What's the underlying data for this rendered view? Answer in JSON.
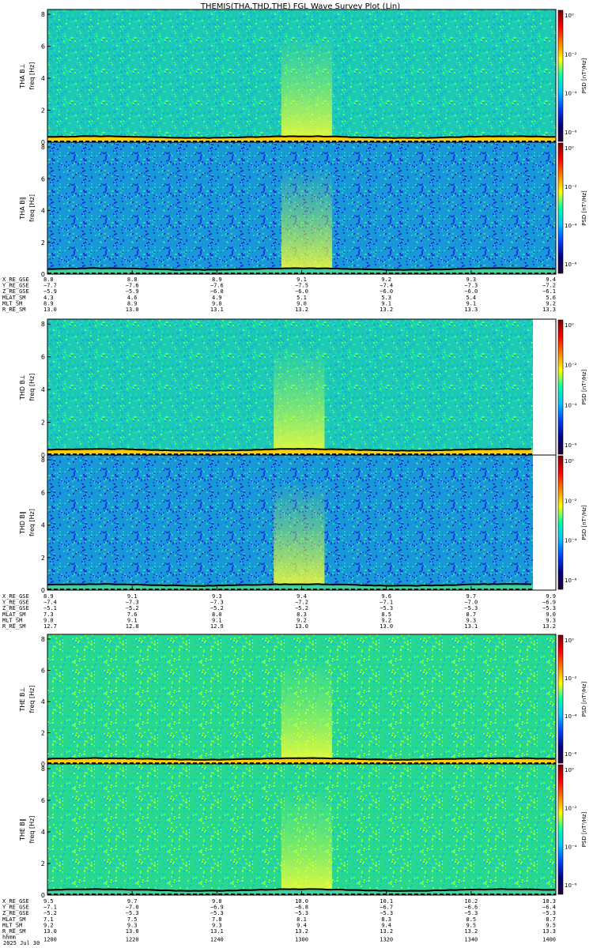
{
  "title": "THEMIS(THA,THD,THE) FGL Wave Survey Plot (Lin)",
  "date_label": "2025 Jul 30",
  "colorbar": {
    "label": "PSD [nT²/Hz]",
    "ticks": [
      "10⁰",
      "10⁻²",
      "10⁻⁴",
      "10⁻⁶"
    ],
    "colors": [
      "#7f0000",
      "#ff0000",
      "#ff8000",
      "#ffff00",
      "#00ffaa",
      "#00c0ff",
      "#0040ff",
      "#000080",
      "#2a0033"
    ]
  },
  "chart_data": [
    {
      "type": "heatmap",
      "probe": "THA",
      "spectra": [
        {
          "name": "THA B⊥",
          "ylabel": "freq [Hz]",
          "ylim": [
            0,
            8.3
          ],
          "yticks": [
            0,
            2,
            4,
            6,
            8
          ],
          "series_label": "THA B⊥"
        },
        {
          "name": "THA B∥",
          "ylabel": "freq [Hz]",
          "ylim": [
            0,
            8.3
          ],
          "yticks": [
            0,
            2,
            4,
            6,
            8
          ],
          "series_label": "THA B∥"
        }
      ],
      "ylabels": [
        "THA B⊥",
        "THA B∥"
      ],
      "coverage_end_fraction": 1.0,
      "ephemeris": {
        "rows": [
          "X_RE_GSE",
          "Y_RE_GSE",
          "Z_RE_GSE",
          "MLAT_SM",
          "MLT_SM",
          "R_RE_SM"
        ],
        "columns": [
          [
            "8.8",
            "-7.7",
            "-5.9",
            "4.3",
            "8.9",
            "13.0"
          ],
          [
            "8.8",
            "-7.6",
            "-5.9",
            "4.6",
            "8.9",
            "13.0"
          ],
          [
            "8.9",
            "-7.6",
            "-6.0",
            "4.9",
            "9.0",
            "13.1"
          ],
          [
            "9.1",
            "-7.5",
            "-6.0",
            "5.1",
            "9.0",
            "13.2"
          ],
          [
            "9.2",
            "-7.4",
            "-6.0",
            "5.3",
            "9.1",
            "13.2"
          ],
          [
            "9.3",
            "-7.3",
            "-6.0",
            "5.4",
            "9.1",
            "13.3"
          ],
          [
            "9.4",
            "-7.2",
            "-6.1",
            "5.6",
            "9.2",
            "13.3"
          ]
        ]
      }
    },
    {
      "type": "heatmap",
      "probe": "THD",
      "spectra": [
        {
          "name": "THD B⊥",
          "ylabel": "freq [Hz]",
          "ylim": [
            0,
            8.3
          ],
          "yticks": [
            0,
            2,
            4,
            6,
            8
          ],
          "series_label": "THD B⊥"
        },
        {
          "name": "THD B∥",
          "ylabel": "freq [Hz]",
          "ylim": [
            0,
            8.3
          ],
          "yticks": [
            0,
            2,
            4,
            6,
            8
          ],
          "series_label": "THD B∥"
        }
      ],
      "ylabels": [
        "THD B⊥",
        "THD B∥"
      ],
      "coverage_end_fraction": 0.955,
      "ephemeris": {
        "rows": [
          "X_RE_GSE",
          "Y_RE_GSE",
          "Z_RE_GSE",
          "MLAT_SM",
          "MLT_SM",
          "R_RE_SM"
        ],
        "columns": [
          [
            "8.9",
            "-7.4",
            "-5.1",
            "7.3",
            "9.0",
            "12.7"
          ],
          [
            "9.1",
            "-7.3",
            "-5.2",
            "7.6",
            "9.1",
            "12.8"
          ],
          [
            "9.3",
            "-7.3",
            "-5.2",
            "8.0",
            "9.1",
            "12.9"
          ],
          [
            "9.4",
            "-7.2",
            "-5.2",
            "8.3",
            "9.2",
            "13.0"
          ],
          [
            "9.6",
            "-7.1",
            "-5.3",
            "8.5",
            "9.2",
            "13.0"
          ],
          [
            "9.7",
            "-7.0",
            "-5.3",
            "8.7",
            "9.3",
            "13.1"
          ],
          [
            "9.9",
            "-6.9",
            "-5.3",
            "9.0",
            "9.3",
            "13.2"
          ]
        ]
      }
    },
    {
      "type": "heatmap",
      "probe": "THE",
      "spectra": [
        {
          "name": "THE B⊥",
          "ylabel": "freq [Hz]",
          "ylim": [
            0,
            8.3
          ],
          "yticks": [
            0,
            2,
            4,
            6,
            8
          ],
          "series_label": "THE B⊥"
        },
        {
          "name": "THE B∥",
          "ylabel": "freq [Hz]",
          "ylim": [
            0,
            8.3
          ],
          "yticks": [
            0,
            2,
            4,
            6,
            8
          ],
          "series_label": "THE B∥"
        }
      ],
      "ylabels": [
        "THE B⊥",
        "THE B∥"
      ],
      "coverage_end_fraction": 1.0,
      "ephemeris": {
        "rows": [
          "X_RE_GSE",
          "Y_RE_GSE",
          "Z_RE_GSE",
          "MLAT_SM",
          "MLT_SM",
          "R_RE_SM"
        ],
        "columns": [
          [
            "9.5",
            "-7.1",
            "-5.2",
            "7.1",
            "9.2",
            "13.0"
          ],
          [
            "9.7",
            "-7.0",
            "-5.3",
            "7.5",
            "9.3",
            "13.0"
          ],
          [
            "9.8",
            "-6.9",
            "-5.3",
            "7.8",
            "9.3",
            "13.1"
          ],
          [
            "10.0",
            "-6.8",
            "-5.3",
            "8.1",
            "9.4",
            "13.2"
          ],
          [
            "10.1",
            "-6.7",
            "-5.3",
            "8.3",
            "9.4",
            "13.2"
          ],
          [
            "10.2",
            "-6.6",
            "-5.3",
            "8.5",
            "9.5",
            "13.2"
          ],
          [
            "10.3",
            "-6.4",
            "-5.3",
            "8.7",
            "9.5",
            "13.3"
          ]
        ]
      },
      "time_axis": {
        "label": "hhmm",
        "ticks": [
          "1200",
          "1220",
          "1240",
          "1300",
          "1320",
          "1340",
          "1400"
        ]
      }
    }
  ]
}
